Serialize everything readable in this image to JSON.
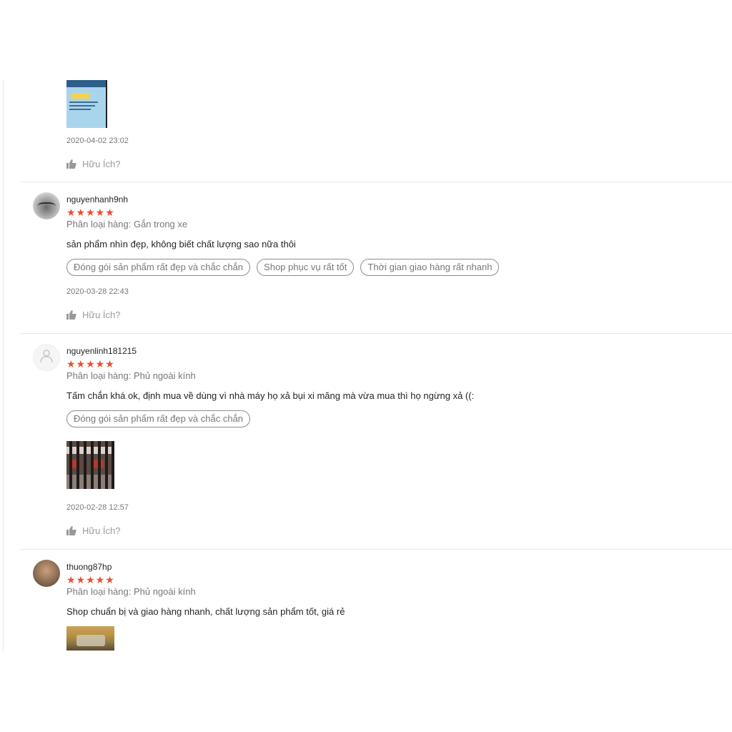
{
  "reviews": [
    {
      "date": "2020-04-02 23:02",
      "helpful_label": "Hữu Ích?",
      "thumb_icon": "thumbs-up-icon"
    },
    {
      "username": "nguyenhanh9nh",
      "rating": 5,
      "stars": "★★★★★",
      "variation": "Phân loại hàng: Gắn trong xe",
      "comment": "sản phẩm nhìn đẹp, không biết chất lượng sao nữa thôi",
      "tags": [
        "Đóng gói sản phẩm rất đẹp và chắc chắn",
        "Shop phục vụ rất tốt",
        "Thời gian giao hàng rất nhanh"
      ],
      "date": "2020-03-28 22:43",
      "helpful_label": "Hữu Ích?"
    },
    {
      "username": "nguyenlinh181215",
      "rating": 5,
      "stars": "★★★★★",
      "variation": "Phân loại hàng: Phủ ngoài kính",
      "comment": "Tấm chắn khá ok, định mua về dùng vì nhà máy họ xả bụi xi măng mà vừa mua thì họ ngừng xả ((:",
      "tags": [
        "Đóng gói sản phẩm rất đẹp và chắc chắn"
      ],
      "date": "2020-02-28 12:57",
      "helpful_label": "Hữu Ích?"
    },
    {
      "username": "thuong87hp",
      "rating": 5,
      "stars": "★★★★★",
      "variation": "Phân loại hàng: Phủ ngoài kính",
      "comment": "Shop chuẩn bị và giao hàng nhanh, chất lượng sản phẩm tốt, giá rẻ"
    }
  ],
  "colors": {
    "star": "#ee4d2d",
    "divider": "#e8e8e8",
    "muted_text": "rgba(0,0,0,0.54)"
  }
}
